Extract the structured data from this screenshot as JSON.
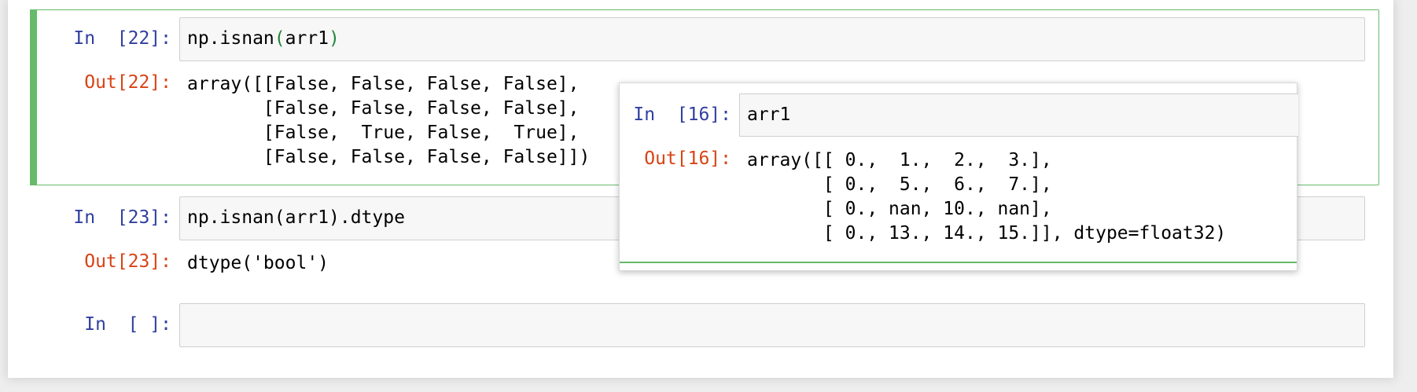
{
  "cells": [
    {
      "in_prompt": "In  [22]:",
      "code_text": "np.isnan",
      "code_paren_open": "(",
      "code_arg": "arr1",
      "code_paren_close": ")",
      "out_prompt": "Out[22]:",
      "output": "array([[False, False, False, False],\n       [False, False, False, False],\n       [False,  True, False,  True],\n       [False, False, False, False]])"
    },
    {
      "in_prompt": "In  [23]:",
      "code": "np.isnan(arr1).dtype",
      "out_prompt": "Out[23]:",
      "output": "dtype('bool')"
    },
    {
      "in_prompt": "In  [ ]:",
      "code": ""
    }
  ],
  "popup": {
    "in_prompt": "In  [16]:",
    "code": "arr1",
    "out_prompt": "Out[16]:",
    "output": "array([[ 0.,  1.,  2.,  3.],\n       [ 0.,  5.,  6.,  7.],\n       [ 0., nan, 10., nan],\n       [ 0., 13., 14., 15.]], dtype=float32)"
  },
  "colors": {
    "in_prompt": "#303f9f",
    "out_prompt": "#d84315",
    "selected_border": "#66bb6a",
    "paren": "#22863a"
  }
}
